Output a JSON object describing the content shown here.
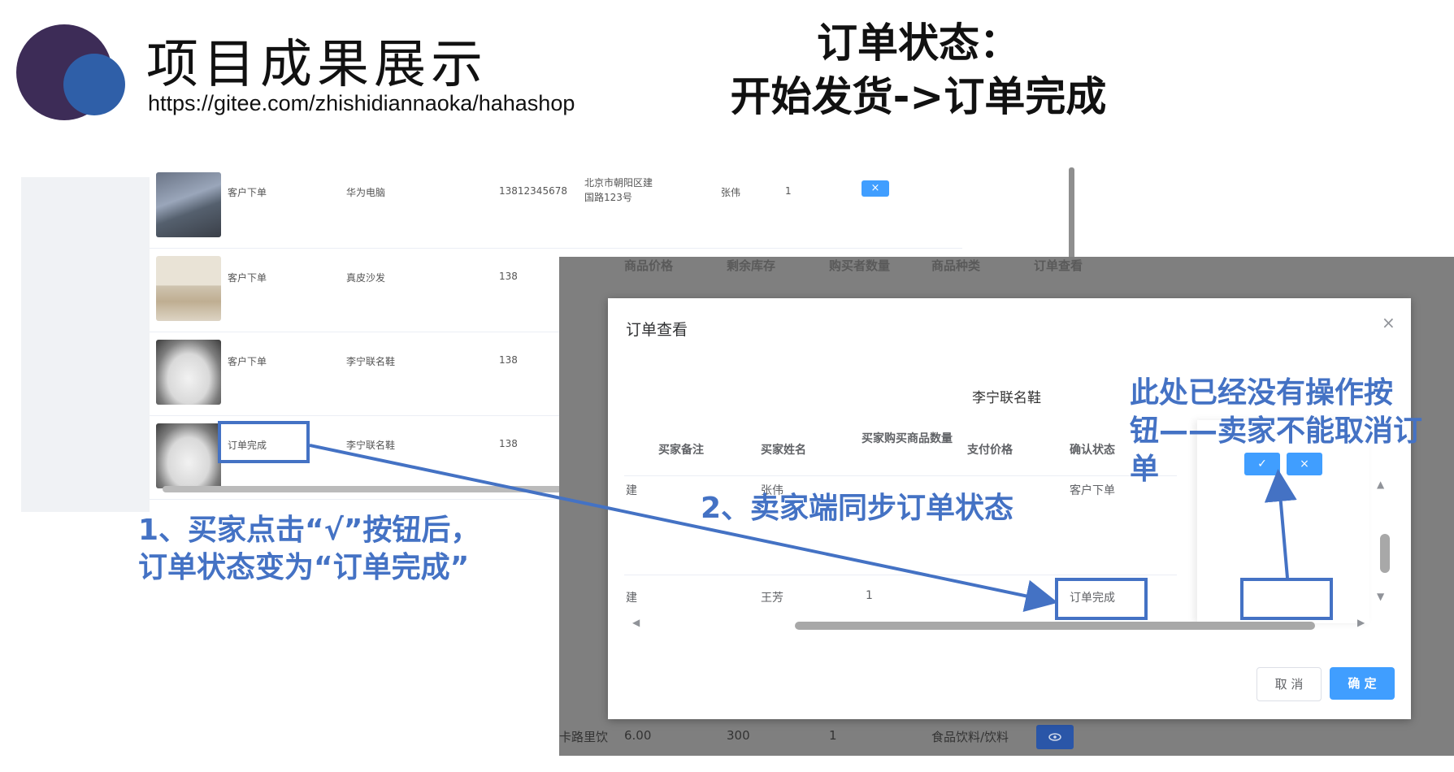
{
  "slide": {
    "title": "项目成果展示",
    "url": "https://gitee.com/zhishidiannaoka/hahashop",
    "heading_line1": "订单状态：",
    "heading_line2": "开始发货->订单完成"
  },
  "back_table": {
    "rows": [
      {
        "thumb": "laptop-image",
        "status": "客户下单",
        "product": "华为电脑",
        "phone": "13812345678",
        "address_line1": "北京市朝阳区建",
        "address_line2": "国路123号",
        "name": "张伟",
        "qty": "1",
        "action": "×"
      },
      {
        "thumb": "sofa-image",
        "status": "客户下单",
        "product": "真皮沙发",
        "phone": "138"
      },
      {
        "thumb": "shoe-image",
        "status": "客户下单",
        "product": "李宁联名鞋",
        "phone": "138"
      },
      {
        "thumb": "shoe-image",
        "status": "订单完成",
        "product": "李宁联名鞋",
        "phone": "138"
      }
    ]
  },
  "seller_table": {
    "headers": [
      "商品价格",
      "剩余库存",
      "购买者数量",
      "商品种类",
      "订单查看"
    ],
    "footer_row": {
      "name": "卡路里饮",
      "price": "6.00",
      "stock": "300",
      "count": "1",
      "category": "食品饮料/饮料"
    },
    "view_icon": "eye-icon"
  },
  "dialog": {
    "title": "订单查看",
    "close": "×",
    "product": "李宁联名鞋",
    "headers": [
      "买家备注",
      "买家姓名",
      "买家购买商品数量",
      "支付价格",
      "确认状态"
    ],
    "row1": {
      "address": "建",
      "name": "张伟",
      "status": "客户下单",
      "confirm": "✓",
      "reject": "×"
    },
    "row2": {
      "address": "建",
      "name": "王芳",
      "qty": "1",
      "status": "订单完成"
    },
    "cancel": "取 消",
    "confirm": "确 定"
  },
  "annotations": {
    "note1_line1": "1、买家点击“√”按钮后，",
    "note1_line2": "订单状态变为“订单完成”",
    "note2": "2、卖家端同步订单状态",
    "note3_line1": "此处已经没有操作按",
    "note3_line2": "钮——卖家不能取消订",
    "note3_line3": "单"
  },
  "colors": {
    "accent": "#4472c4",
    "primary_button": "#409eff",
    "overlay": "#7f7f7f"
  }
}
